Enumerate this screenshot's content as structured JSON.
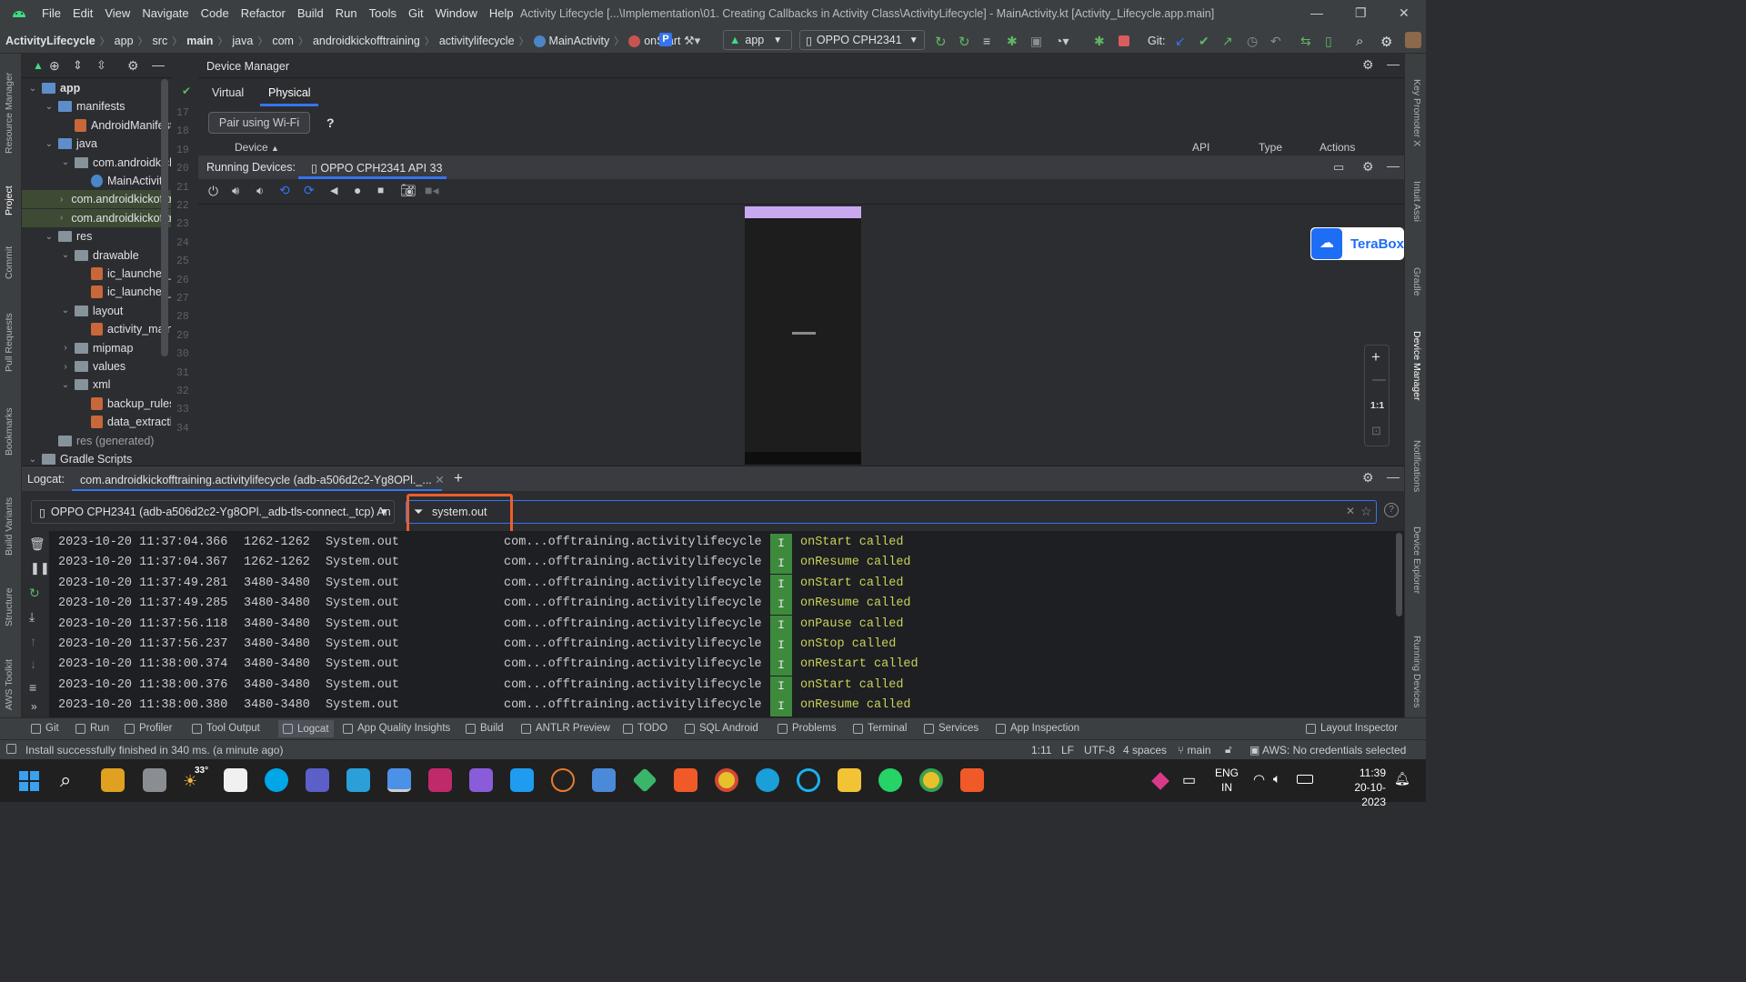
{
  "menu": [
    "File",
    "Edit",
    "View",
    "Navigate",
    "Code",
    "Refactor",
    "Build",
    "Run",
    "Tools",
    "Git",
    "Window",
    "Help"
  ],
  "window_title": "Activity Lifecycle [...\\Implementation\\01. Creating Callbacks in Activity Class\\ActivityLifecycle] - MainActivity.kt [Activity_Lifecycle.app.main]",
  "breadcrumbs": [
    "ActivityLifecycle",
    "app",
    "src",
    "main",
    "java",
    "com",
    "androidkickofftraining",
    "activitylifecycle",
    "MainActivity",
    "onStart"
  ],
  "run_config": "app",
  "device_select": "OPPO CPH2341",
  "git_label": "Git:",
  "left_strip": [
    "Resource Manager",
    "Project",
    "Commit",
    "Pull Requests",
    "Bookmarks",
    "Build Variants",
    "Structure",
    "AWS Toolkit"
  ],
  "right_strip": [
    "Key Promoter X",
    "Intuit Assi",
    "Gradle",
    "Device Manager",
    "Notifications",
    "Device Explorer",
    "Running Devices"
  ],
  "project_tree": [
    {
      "label": "app",
      "depth": 0,
      "arrow": "down",
      "kind": "folder-mod",
      "bold": true
    },
    {
      "label": "manifests",
      "depth": 1,
      "arrow": "down",
      "kind": "folder-blue"
    },
    {
      "label": "AndroidManifest.xml",
      "depth": 2,
      "arrow": "",
      "kind": "file-xml"
    },
    {
      "label": "java",
      "depth": 1,
      "arrow": "down",
      "kind": "folder-blue"
    },
    {
      "label": "com.androidkickofftraining.activitylifecycle",
      "depth": 2,
      "arrow": "down",
      "kind": "folder"
    },
    {
      "label": "MainActivity",
      "depth": 3,
      "arrow": "",
      "kind": "file-kt"
    },
    {
      "label": "com.androidkickofftraining.activitylifecycle (androidTest)",
      "depth": 2,
      "arrow": "right",
      "kind": "folder",
      "hl": true
    },
    {
      "label": "com.androidkickofftraining.activitylifecycle (test)",
      "depth": 2,
      "arrow": "right",
      "kind": "folder",
      "hl": true
    },
    {
      "label": "res",
      "depth": 1,
      "arrow": "down",
      "kind": "folder-res"
    },
    {
      "label": "drawable",
      "depth": 2,
      "arrow": "down",
      "kind": "folder"
    },
    {
      "label": "ic_launcher_background.xml",
      "depth": 3,
      "arrow": "",
      "kind": "file-xml"
    },
    {
      "label": "ic_launcher_foreground.xml",
      "depth": 3,
      "arrow": "",
      "kind": "file-xml"
    },
    {
      "label": "layout",
      "depth": 2,
      "arrow": "down",
      "kind": "folder"
    },
    {
      "label": "activity_main.xml",
      "depth": 3,
      "arrow": "",
      "kind": "file-xml"
    },
    {
      "label": "mipmap",
      "depth": 2,
      "arrow": "right",
      "kind": "folder"
    },
    {
      "label": "values",
      "depth": 2,
      "arrow": "right",
      "kind": "folder"
    },
    {
      "label": "xml",
      "depth": 2,
      "arrow": "down",
      "kind": "folder"
    },
    {
      "label": "backup_rules.xml",
      "depth": 3,
      "arrow": "",
      "kind": "file-xml"
    },
    {
      "label": "data_extraction_rules.xml",
      "depth": 3,
      "arrow": "",
      "kind": "file-xml"
    },
    {
      "label": "res (generated)",
      "depth": 1,
      "arrow": "",
      "kind": "folder-res",
      "dim": true
    },
    {
      "label": "Gradle Scripts",
      "depth": 0,
      "arrow": "down",
      "kind": "gradle"
    }
  ],
  "gutter_lines": [
    "17",
    "18",
    "19",
    "20",
    "21",
    "22",
    "23",
    "24",
    "25",
    "26",
    "27",
    "28",
    "29",
    "30",
    "31",
    "32",
    "33",
    "34"
  ],
  "device_manager": {
    "title": "Device Manager",
    "tabs": [
      "Virtual",
      "Physical"
    ],
    "active_tab": "Physical",
    "pair_button": "Pair using Wi-Fi",
    "help": "?",
    "columns": [
      "Device",
      "API",
      "Type",
      "Actions"
    ]
  },
  "running_devices": {
    "label": "Running Devices:",
    "tab": "OPPO CPH2341 API 33",
    "zoom_11": "1:1"
  },
  "terabox": "TeraBox",
  "logcat": {
    "label": "Logcat:",
    "tab": "com.androidkickofftraining.activitylifecycle (adb-a506d2c2-Yg8OPl._...",
    "device": "OPPO CPH2341 (adb-a506d2c2-Yg8OPl._adb-tls-connect._tcp) An",
    "filter": "system.out",
    "rows": [
      {
        "ts": "2023-10-20 11:37:04.366",
        "pid": "1262-1262",
        "tag": "System.out",
        "pkg": "com...offtraining.activitylifecycle",
        "lvl": "I",
        "msg": "onStart called"
      },
      {
        "ts": "2023-10-20 11:37:04.367",
        "pid": "1262-1262",
        "tag": "System.out",
        "pkg": "com...offtraining.activitylifecycle",
        "lvl": "I",
        "msg": "onResume called"
      },
      {
        "ts": "2023-10-20 11:37:49.281",
        "pid": "3480-3480",
        "tag": "System.out",
        "pkg": "com...offtraining.activitylifecycle",
        "lvl": "I",
        "msg": "onStart called"
      },
      {
        "ts": "2023-10-20 11:37:49.285",
        "pid": "3480-3480",
        "tag": "System.out",
        "pkg": "com...offtraining.activitylifecycle",
        "lvl": "I",
        "msg": "onResume called"
      },
      {
        "ts": "2023-10-20 11:37:56.118",
        "pid": "3480-3480",
        "tag": "System.out",
        "pkg": "com...offtraining.activitylifecycle",
        "lvl": "I",
        "msg": "onPause called"
      },
      {
        "ts": "2023-10-20 11:37:56.237",
        "pid": "3480-3480",
        "tag": "System.out",
        "pkg": "com...offtraining.activitylifecycle",
        "lvl": "I",
        "msg": "onStop called"
      },
      {
        "ts": "2023-10-20 11:38:00.374",
        "pid": "3480-3480",
        "tag": "System.out",
        "pkg": "com...offtraining.activitylifecycle",
        "lvl": "I",
        "msg": "onRestart called"
      },
      {
        "ts": "2023-10-20 11:38:00.376",
        "pid": "3480-3480",
        "tag": "System.out",
        "pkg": "com...offtraining.activitylifecycle",
        "lvl": "I",
        "msg": "onStart called"
      },
      {
        "ts": "2023-10-20 11:38:00.380",
        "pid": "3480-3480",
        "tag": "System.out",
        "pkg": "com...offtraining.activitylifecycle",
        "lvl": "I",
        "msg": "onResume called"
      }
    ]
  },
  "bottom_tabs": [
    "Git",
    "Run",
    "Profiler",
    "Tool Output",
    "Logcat",
    "App Quality Insights",
    "Build",
    "ANTLR Preview",
    "TODO",
    "SQL Android",
    "Problems",
    "Terminal",
    "Services",
    "App Inspection"
  ],
  "layout_inspector": "Layout Inspector",
  "status": {
    "message": "Install successfully finished in 340 ms. (a minute ago)",
    "position": "1:11",
    "line_sep": "LF",
    "encoding": "UTF-8",
    "indent": "4 spaces",
    "branch": "main",
    "aws": "AWS: No credentials selected"
  },
  "taskbar": {
    "weather": "33°",
    "lang1": "ENG",
    "lang2": "IN",
    "time": "11:39",
    "date": "20-10-2023"
  },
  "colors": {
    "accent": "#3574f0",
    "log_message": "#c8d15a",
    "log_level_bg": "#3d8a3d",
    "highlight_box": "#e8602c"
  }
}
